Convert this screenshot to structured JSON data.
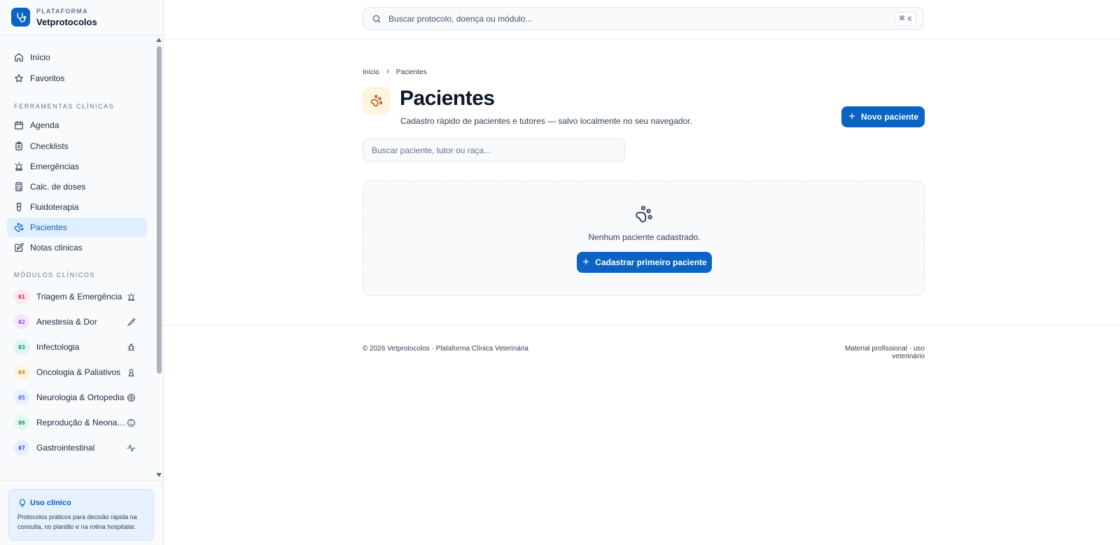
{
  "brand": {
    "top": "PLATAFORMA",
    "name": "Vetprotocolos"
  },
  "nav": {
    "primary": [
      {
        "label": "Início",
        "icon": "home-icon"
      },
      {
        "label": "Favoritos",
        "icon": "star-icon"
      }
    ],
    "tools_title": "FERRAMENTAS CLÍNICAS",
    "tools": [
      {
        "label": "Agenda",
        "icon": "calendar-icon"
      },
      {
        "label": "Checklists",
        "icon": "clipboard-icon"
      },
      {
        "label": "Emergências",
        "icon": "siren-icon"
      },
      {
        "label": "Calc. de doses",
        "icon": "calculator-icon"
      },
      {
        "label": "Fluidoterapia",
        "icon": "iv-bag-icon"
      },
      {
        "label": "Pacientes",
        "icon": "paw-icon",
        "active": true
      },
      {
        "label": "Notas clínicas",
        "icon": "note-edit-icon"
      }
    ],
    "modules_title": "MÓDULOS CLÍNICOS",
    "modules": [
      {
        "num": "01",
        "label": "Triagem & Emergência",
        "color": "#e11d48",
        "bg": "#fde8ec",
        "icon": "siren-icon"
      },
      {
        "num": "02",
        "label": "Anestesia & Dor",
        "color": "#9333ea",
        "bg": "#f3e8ff",
        "icon": "syringe-icon"
      },
      {
        "num": "03",
        "label": "Infectologia",
        "color": "#0d9488",
        "bg": "#e0f5f2",
        "icon": "bug-icon"
      },
      {
        "num": "04",
        "label": "Oncologia & Paliativos",
        "color": "#d97706",
        "bg": "#fef3e0",
        "icon": "ribbon-icon"
      },
      {
        "num": "05",
        "label": "Neurologia & Ortopedia",
        "color": "#2563eb",
        "bg": "#e8f0fe",
        "icon": "brain-icon"
      },
      {
        "num": "06",
        "label": "Reprodução & Neonatologia",
        "color": "#059669",
        "bg": "#e3f7ee",
        "icon": "baby-icon"
      },
      {
        "num": "07",
        "label": "Gastrointestinal",
        "color": "#1d4ed8",
        "bg": "#e8eefc",
        "icon": "activity-icon"
      }
    ]
  },
  "uso": {
    "title": "Uso clínico",
    "text": "Protocolos práticos para decisão rápida na consulta, no plantão e na rotina hospitalar."
  },
  "search": {
    "placeholder": "Buscar protocolo, doença ou módulo...",
    "kbd_mod": "⌘",
    "kbd_key": "K"
  },
  "breadcrumb": {
    "home": "Início",
    "current": "Pacientes"
  },
  "page": {
    "title": "Pacientes",
    "subtitle": "Cadastro rápido de pacientes e tutores — salvo localmente no seu navegador.",
    "new_button": "Novo paciente",
    "filter_placeholder": "Buscar paciente, tutor ou raça...",
    "empty_text": "Nenhum paciente cadastrado.",
    "empty_button": "Cadastrar primeiro paciente"
  },
  "footer": {
    "left": "© 2026 Vetprotocolos · Plataforma Clínica Veterinária",
    "right": "Material profissional · uso veterinário"
  },
  "colors": {
    "primary": "#0b63c4",
    "active_bg": "#e0efff",
    "page_icon_bg": "#fff4e0"
  }
}
